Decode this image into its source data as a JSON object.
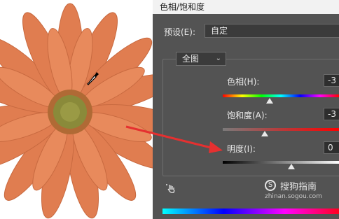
{
  "dialog": {
    "title": "色相/饱和度",
    "preset_label": "预设(E):",
    "preset_value": "自定",
    "channel_value": "全图",
    "hue": {
      "label": "色相(H):",
      "value": "-3",
      "level": 0.5
    },
    "saturation": {
      "label": "饱和度(A):",
      "value": "-3",
      "level": 0.5
    },
    "lightness": {
      "label": "明度(I):",
      "value": "0",
      "level": 0.5
    }
  },
  "watermark": {
    "brand": "搜狗指南",
    "url": "zhinan.sogou.com"
  },
  "colors": {
    "petal": "#e07d50",
    "flower_center": "#8a8a3a",
    "arrow": "#e53030",
    "dialog_bg": "#535353"
  },
  "icons": [
    "eyedropper-icon",
    "hand-scrubby-icon",
    "chevron-down-icon",
    "sogou-logo-icon"
  ]
}
